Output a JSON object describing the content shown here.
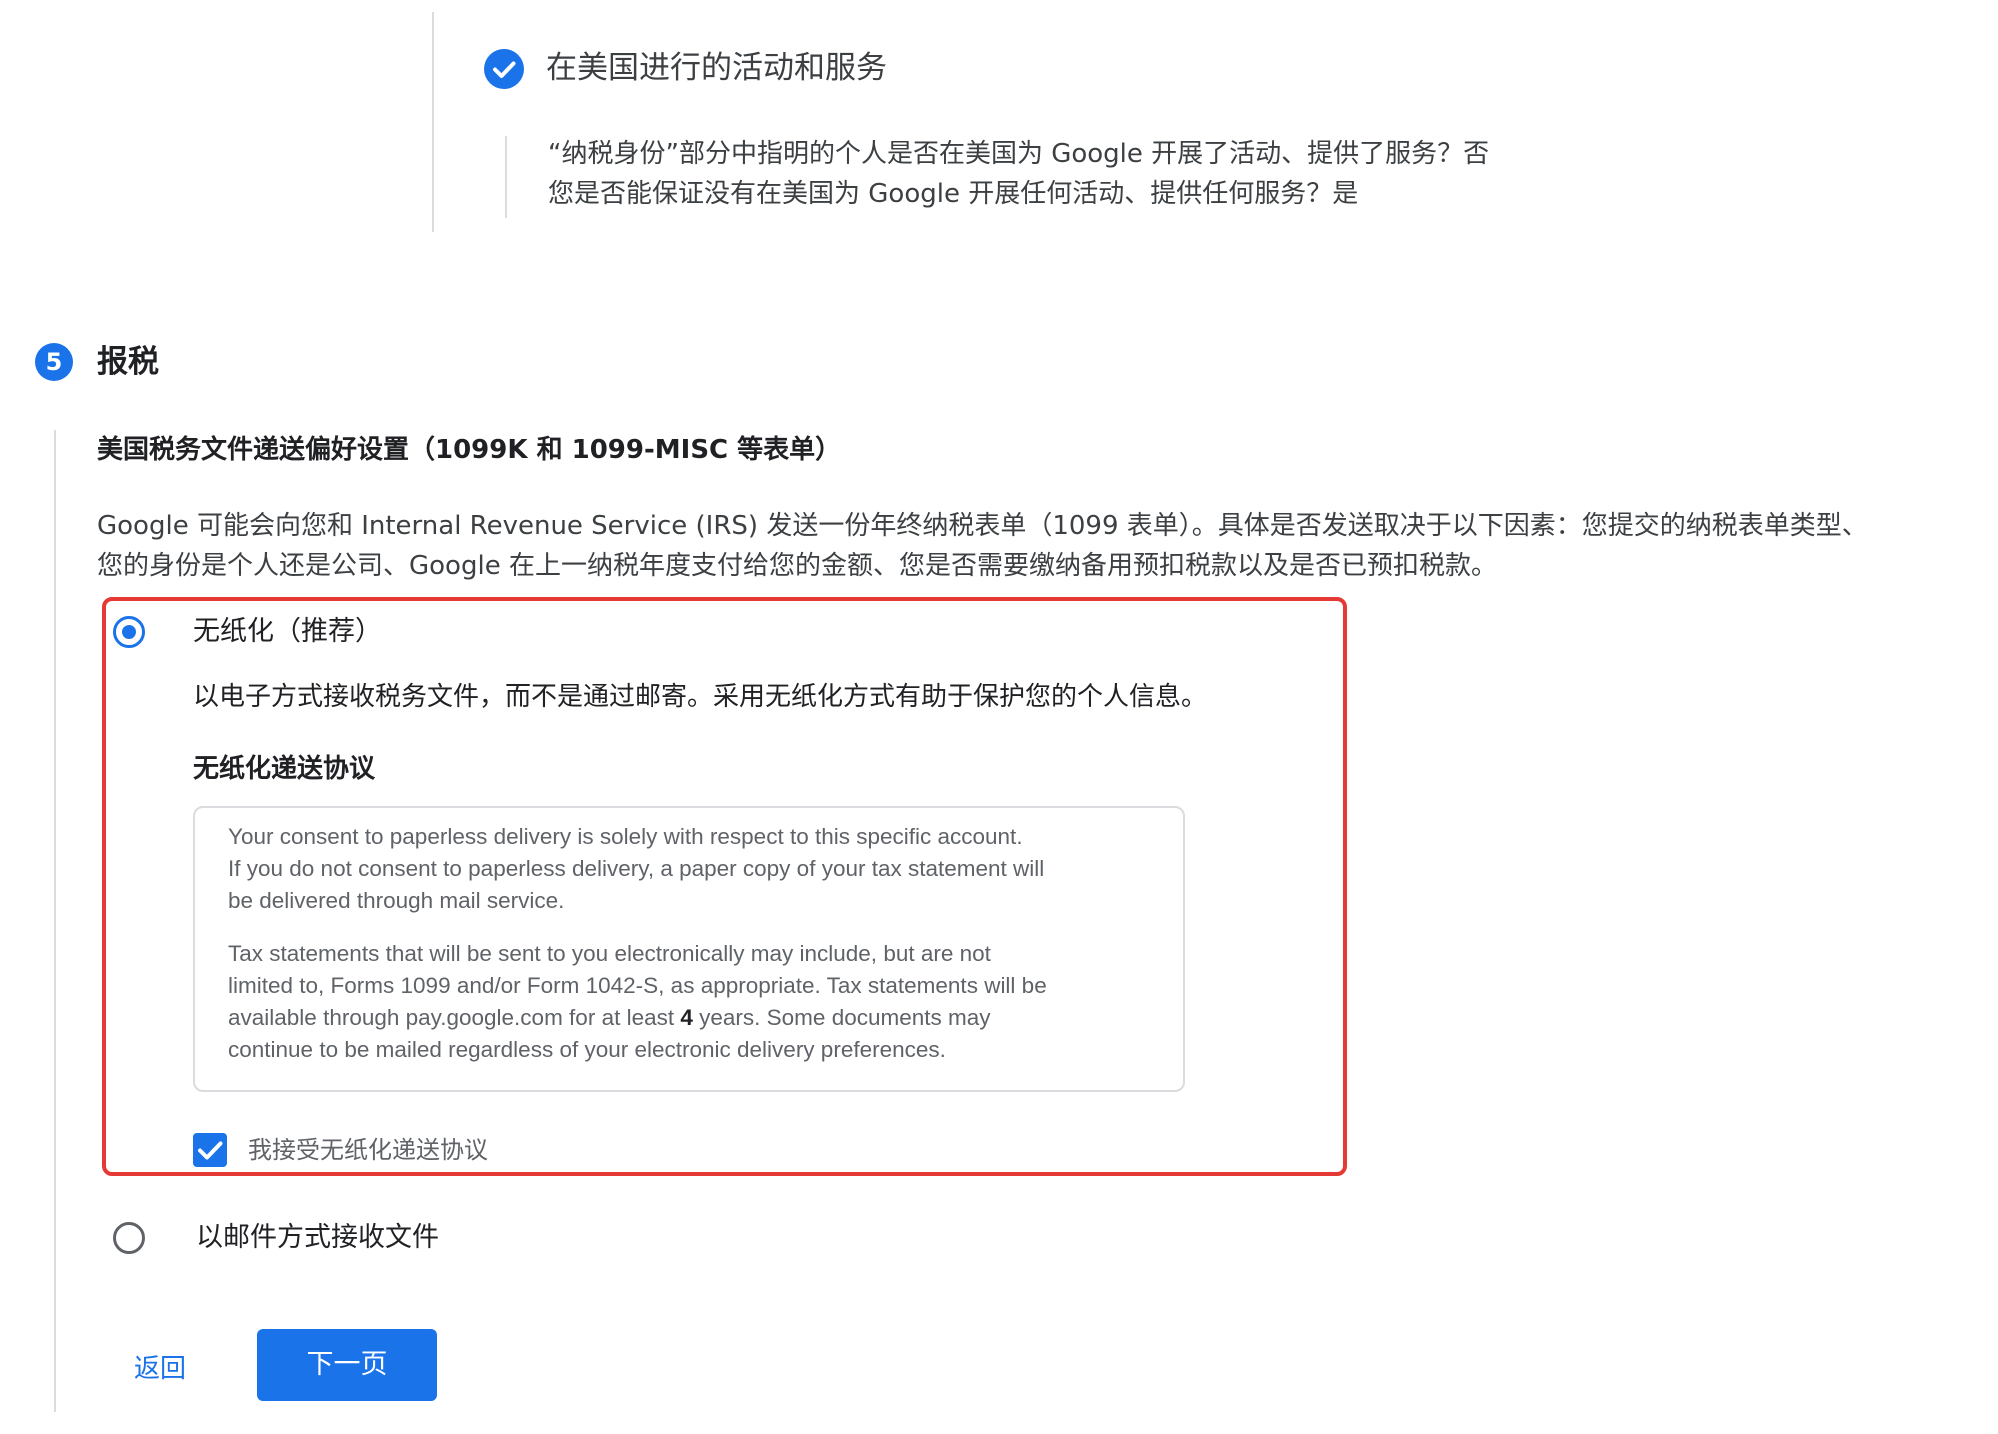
{
  "completed_step": {
    "title": "在美国进行的活动和服务",
    "summary_line_1": "“纳税身份”部分中指明的个人是否在美国为 Google 开展了活动、提供了服务？否",
    "summary_line_2": "您是否能保证没有在美国为 Google 开展任何活动、提供任何服务？是"
  },
  "step5": {
    "number": "5",
    "title": "报税",
    "section_heading": "美国税务文件递送偏好设置（1099K 和 1099-MISC 等表单）",
    "description_line_1": "Google 可能会向您和 Internal Revenue Service (IRS) 发送一份年终纳税表单（1099 表单）。具体是否发送取决于以下因素：您提交的纳税表单类型、",
    "description_line_2": "您的身份是个人还是公司、Google 在上一纳税年度支付给您的金额、您是否需要缴纳备用预扣税款以及是否已预扣税款。",
    "options": {
      "paperless": {
        "label": "无纸化（推荐）",
        "selected": true,
        "description": "以电子方式接收税务文件，而不是通过邮寄。采用无纸化方式有助于保护您的个人信息。",
        "agreement_title": "无纸化递送协议",
        "agreement": {
          "line_1": "Your consent to paperless delivery is solely with respect to this specific account.",
          "line_2": "If you do not consent to paperless delivery, a paper copy of your tax statement will",
          "line_3": "be delivered through mail service.",
          "line_4": "Tax statements that will be sent to you electronically may include, but are not",
          "line_5": "limited to, Forms 1099 and/or Form 1042-S, as appropriate. Tax statements will be",
          "line_6_before": "available through pay.google.com for at least ",
          "line_6_bold": "4",
          "line_6_after": " years. Some documents may",
          "line_7": "continue to be mailed regardless of your electronic delivery preferences."
        },
        "consent_label": "我接受无纸化递送协议",
        "consent_checked": true
      },
      "mail": {
        "label": "以邮件方式接收文件",
        "selected": false
      }
    },
    "buttons": {
      "back": "返回",
      "next": "下一页"
    }
  },
  "colors": {
    "accent": "#1a73e8",
    "highlight_border": "#e53935",
    "divider": "#dadce0"
  }
}
